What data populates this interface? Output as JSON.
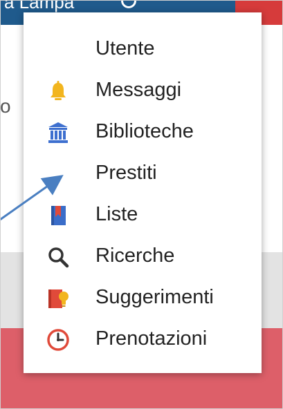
{
  "background": {
    "topbar_text": "a Lampa",
    "partial_text": "o",
    "topbar_color": "#1f5a8c",
    "topbar_accent": "#d63b3b",
    "grey_band_color": "#e3e3e3",
    "red_band_color": "#dd5f69"
  },
  "menu": {
    "items": [
      {
        "label": "Utente",
        "icon": "none"
      },
      {
        "label": "Messaggi",
        "icon": "bell-icon",
        "color": "#f2b51e"
      },
      {
        "label": "Biblioteche",
        "icon": "library-icon",
        "color": "#3d6fcf"
      },
      {
        "label": "Prestiti",
        "icon": "none"
      },
      {
        "label": "Liste",
        "icon": "bookmark-book-icon",
        "color": "#3a6dc9"
      },
      {
        "label": "Ricerche",
        "icon": "search-icon",
        "color": "#333333"
      },
      {
        "label": "Suggerimenti",
        "icon": "book-lightbulb-icon",
        "color": "#e04a3a"
      },
      {
        "label": "Prenotazioni",
        "icon": "clock-icon",
        "color": "#e04a3a"
      }
    ]
  },
  "annotation": {
    "arrow_color": "#4a7fc1"
  }
}
